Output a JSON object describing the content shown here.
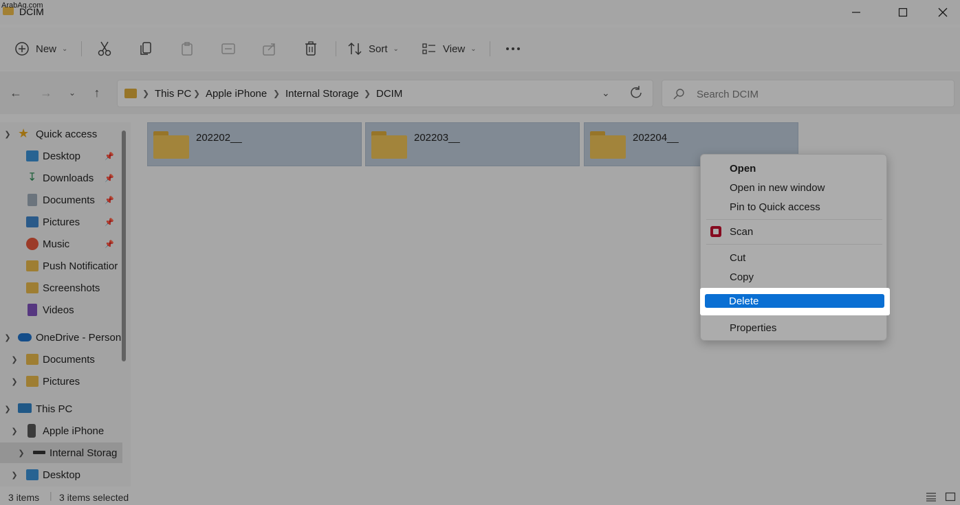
{
  "watermark": "ArabAq.com",
  "window": {
    "title": "DCIM"
  },
  "toolbar": {
    "new_label": "New",
    "sort_label": "Sort",
    "view_label": "View"
  },
  "address": {
    "crumbs": [
      "This PC",
      "Apple iPhone",
      "Internal Storage",
      "DCIM"
    ],
    "search_placeholder": "Search DCIM"
  },
  "sidebar": {
    "items": [
      {
        "label": "Quick access"
      },
      {
        "label": "Desktop"
      },
      {
        "label": "Downloads"
      },
      {
        "label": "Documents"
      },
      {
        "label": "Pictures"
      },
      {
        "label": "Music"
      },
      {
        "label": "Push Notificatior"
      },
      {
        "label": "Screenshots"
      },
      {
        "label": "Videos"
      },
      {
        "label": "OneDrive - Person"
      },
      {
        "label": "Documents"
      },
      {
        "label": "Pictures"
      },
      {
        "label": "This PC"
      },
      {
        "label": "Apple iPhone"
      },
      {
        "label": "Internal Storag"
      },
      {
        "label": "Desktop"
      }
    ]
  },
  "folders": [
    {
      "name": "202202__"
    },
    {
      "name": "202203__"
    },
    {
      "name": "202204__"
    }
  ],
  "context_menu": {
    "open": "Open",
    "open_new_window": "Open in new window",
    "pin_quick_access": "Pin to Quick access",
    "scan": "Scan",
    "cut": "Cut",
    "copy": "Copy",
    "delete": "Delete",
    "properties": "Properties"
  },
  "status": {
    "count": "3 items",
    "selected": "3 items selected"
  },
  "colors": {
    "selection_tile": "#b9c6d4",
    "menu_highlight": "#0a6fd3",
    "folder": "#e8be55"
  }
}
